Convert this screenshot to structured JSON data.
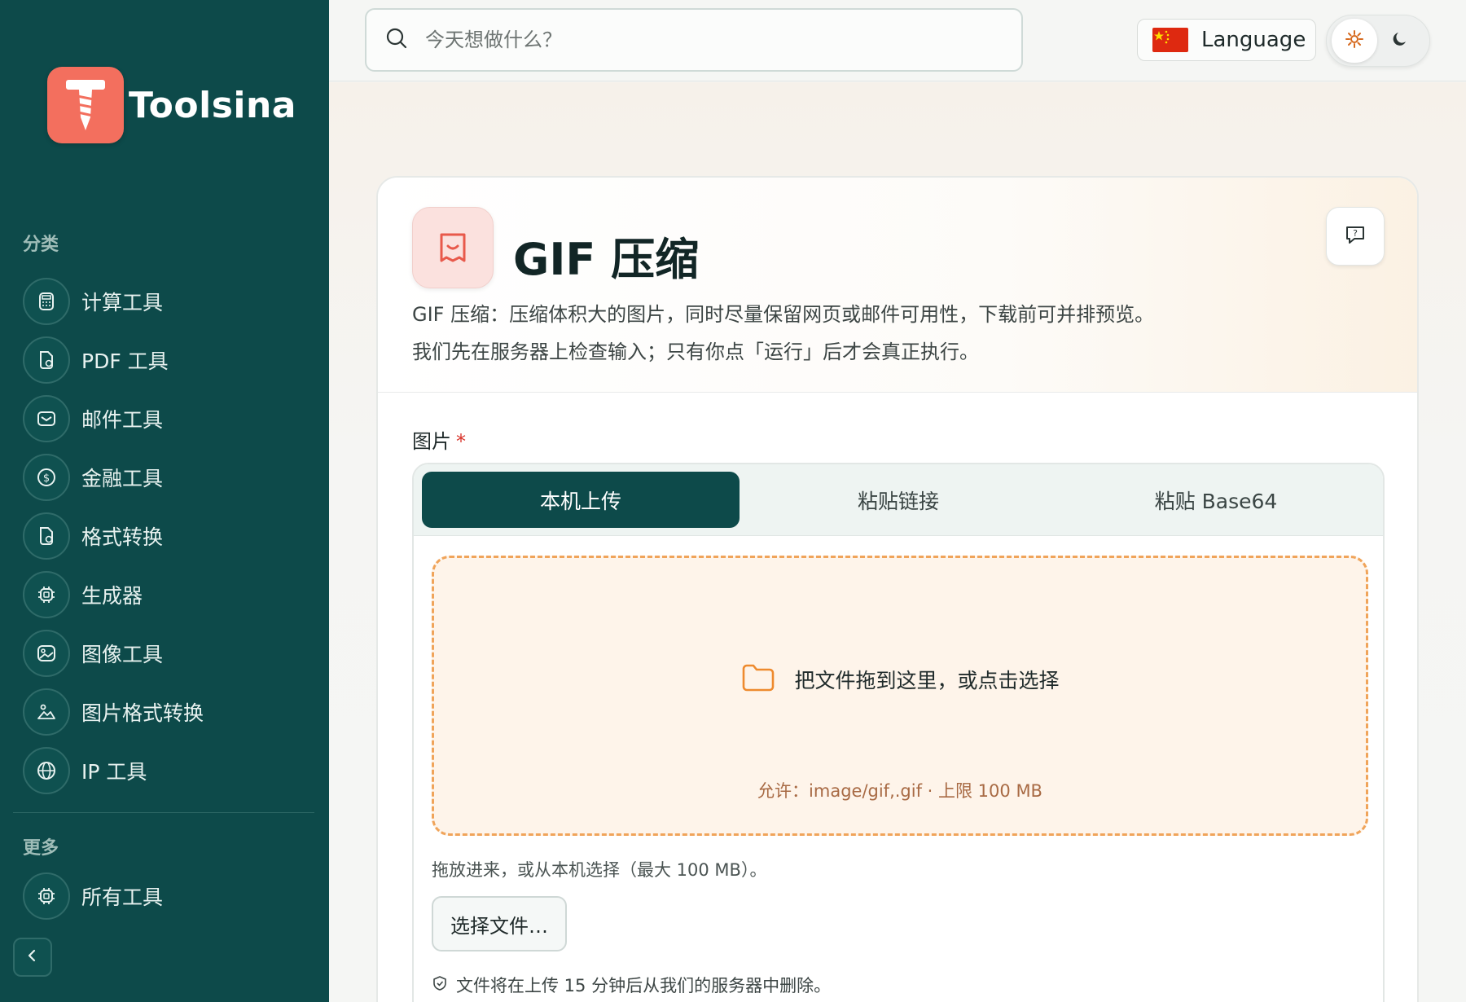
{
  "brand": {
    "name": "Toolsina",
    "accent": "#f36f5e",
    "sidebar_bg": "#0d4a4a"
  },
  "sidebar": {
    "categories_heading": "分类",
    "items": [
      {
        "label": "计算工具",
        "icon": "calculator-icon"
      },
      {
        "label": "PDF 工具",
        "icon": "document-icon"
      },
      {
        "label": "邮件工具",
        "icon": "mail-icon"
      },
      {
        "label": "金融工具",
        "icon": "dollar-icon"
      },
      {
        "label": "格式转换",
        "icon": "document-icon"
      },
      {
        "label": "生成器",
        "icon": "chip-icon"
      },
      {
        "label": "图像工具",
        "icon": "image-icon"
      },
      {
        "label": "图片格式转换",
        "icon": "landscape-icon"
      },
      {
        "label": "IP 工具",
        "icon": "globe-icon"
      }
    ],
    "more_heading": "更多",
    "more_items": [
      {
        "label": "所有工具",
        "icon": "chip-icon"
      }
    ]
  },
  "search": {
    "placeholder": "今天想做什么？"
  },
  "language": {
    "label": "Language",
    "flag": "cn-flag-icon"
  },
  "tool": {
    "title": "GIF 压缩",
    "description_1": "GIF 压缩：压缩体积大的图片，同时尽量保留网页或邮件可用性，下载前可并排预览。",
    "description_2": "我们先在服务器上检查输入；只有你点「运行」后才会真正执行。"
  },
  "form": {
    "field_label": "图片",
    "required_mark": "*",
    "tabs": [
      {
        "label": "本机上传",
        "active": true
      },
      {
        "label": "粘贴链接",
        "active": false
      },
      {
        "label": "粘贴 Base64",
        "active": false
      }
    ],
    "dropzone": {
      "main_text": "把文件拖到这里，或点击选择",
      "allowed_text": "允许：image/gif,.gif · 上限 100 MB"
    },
    "help_text": "拖放进来，或从本机选择（最大 100 MB）。",
    "choose_button": "选择文件…",
    "retention_note": "文件将在上传 15 分钟后从我们的服务器中删除。"
  }
}
